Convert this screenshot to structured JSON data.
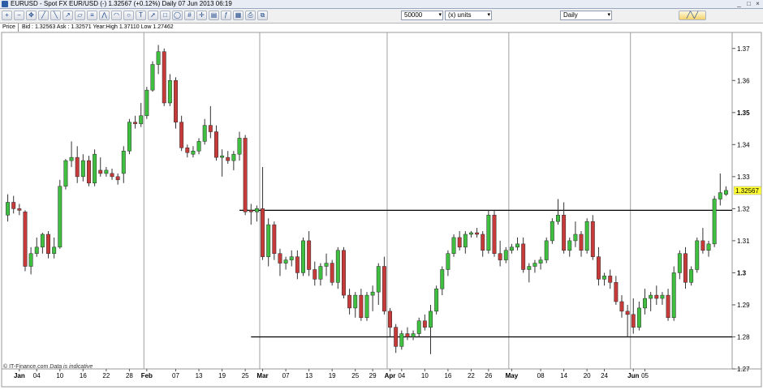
{
  "window": {
    "title": "EURUSD - Spot FX EUR/USD (-)   1.32567 (+0.12%)   Daily  07 Jun 2013 06:19",
    "icon": "chart-window-icon"
  },
  "toolbar": {
    "quantity_value": "50000",
    "units_value": "(x) units",
    "interval_value": "Daily",
    "tool_icons": [
      "zoom-in-icon",
      "zoom-out-icon",
      "pan-icon",
      "trendline-icon",
      "trendline-icon",
      "ray-icon",
      "channel-icon",
      "fib-icon",
      "fan-icon",
      "arc-icon",
      "cycle-icon",
      "text-icon",
      "arrow-icon",
      "rectangle-icon",
      "ellipse-icon",
      "grid-icon",
      "crosshair-icon",
      "layers-icon",
      "indicator-icon",
      "template-icon",
      "print-icon",
      "copy-icon"
    ]
  },
  "info": {
    "price_label": "Price",
    "quote_text": "Bid : 1.32563 Ask : 1.32571  Year:High 1.37110 Low 1.27462"
  },
  "footer": {
    "source": "© IT-Finance.com",
    "note": "Data is indicative"
  },
  "colors": {
    "bull": "#3fbf3f",
    "bear": "#c73a3a",
    "grid": "#c8c8c8",
    "current_price_bg": "#ffff33"
  },
  "chart_data": {
    "type": "candlestick",
    "y_range": [
      1.27,
      1.375
    ],
    "y_ticks": [
      {
        "v": 1.37,
        "label": "1.37",
        "bold": false
      },
      {
        "v": 1.36,
        "label": "1.36",
        "bold": false
      },
      {
        "v": 1.35,
        "label": "1.35",
        "bold": true
      },
      {
        "v": 1.34,
        "label": "1.34",
        "bold": false
      },
      {
        "v": 1.33,
        "label": "1.33",
        "bold": false
      },
      {
        "v": 1.32,
        "label": "1.32",
        "bold": false
      },
      {
        "v": 1.31,
        "label": "1.31",
        "bold": false
      },
      {
        "v": 1.3,
        "label": "1.3",
        "bold": true
      },
      {
        "v": 1.29,
        "label": "1.29",
        "bold": false
      },
      {
        "v": 1.28,
        "label": "1.28",
        "bold": false
      },
      {
        "v": 1.27,
        "label": "1.27",
        "bold": false
      }
    ],
    "x_labels": [
      {
        "label": "Jan",
        "bold": true,
        "i": 2
      },
      {
        "label": "04",
        "bold": false,
        "i": 5
      },
      {
        "label": "10",
        "bold": false,
        "i": 9
      },
      {
        "label": "16",
        "bold": false,
        "i": 13
      },
      {
        "label": "22",
        "bold": false,
        "i": 17
      },
      {
        "label": "28",
        "bold": false,
        "i": 21
      },
      {
        "label": "Feb",
        "bold": true,
        "i": 24
      },
      {
        "label": "07",
        "bold": false,
        "i": 29
      },
      {
        "label": "13",
        "bold": false,
        "i": 33
      },
      {
        "label": "19",
        "bold": false,
        "i": 37
      },
      {
        "label": "25",
        "bold": false,
        "i": 41
      },
      {
        "label": "Mar",
        "bold": true,
        "i": 44
      },
      {
        "label": "07",
        "bold": false,
        "i": 48
      },
      {
        "label": "13",
        "bold": false,
        "i": 52
      },
      {
        "label": "19",
        "bold": false,
        "i": 56
      },
      {
        "label": "25",
        "bold": false,
        "i": 60
      },
      {
        "label": "29",
        "bold": false,
        "i": 63
      },
      {
        "label": "Apr",
        "bold": true,
        "i": 66
      },
      {
        "label": "04",
        "bold": false,
        "i": 68
      },
      {
        "label": "10",
        "bold": false,
        "i": 72
      },
      {
        "label": "16",
        "bold": false,
        "i": 76
      },
      {
        "label": "22",
        "bold": false,
        "i": 80
      },
      {
        "label": "26",
        "bold": false,
        "i": 83
      },
      {
        "label": "May",
        "bold": true,
        "i": 87
      },
      {
        "label": "08",
        "bold": false,
        "i": 92
      },
      {
        "label": "14",
        "bold": false,
        "i": 96
      },
      {
        "label": "20",
        "bold": false,
        "i": 100
      },
      {
        "label": "24",
        "bold": false,
        "i": 103
      },
      {
        "label": "Jun",
        "bold": true,
        "i": 108
      },
      {
        "label": "05",
        "bold": false,
        "i": 110
      }
    ],
    "month_separators": [
      24,
      44,
      66,
      87,
      108
    ],
    "horizontal_lines": [
      {
        "value": 1.3195,
        "from_i": 40,
        "to_i": 116
      },
      {
        "value": 1.28,
        "from_i": 42,
        "to_i": 116
      }
    ],
    "current_price_label": "1.32567",
    "current_price": 1.32567,
    "candles": [
      [
        1.318,
        1.3245,
        1.316,
        1.322
      ],
      [
        1.322,
        1.324,
        1.3185,
        1.32
      ],
      [
        1.32,
        1.3215,
        1.318,
        1.3195
      ],
      [
        1.319,
        1.3195,
        1.3005,
        1.302
      ],
      [
        1.302,
        1.308,
        1.2995,
        1.306
      ],
      [
        1.306,
        1.311,
        1.305,
        1.308
      ],
      [
        1.308,
        1.3125,
        1.306,
        1.312
      ],
      [
        1.312,
        1.313,
        1.3045,
        1.306
      ],
      [
        1.306,
        1.311,
        1.3045,
        1.308
      ],
      [
        1.308,
        1.329,
        1.3075,
        1.327
      ],
      [
        1.327,
        1.3355,
        1.326,
        1.335
      ],
      [
        1.335,
        1.341,
        1.333,
        1.336
      ],
      [
        1.336,
        1.3395,
        1.328,
        1.33
      ],
      [
        1.33,
        1.337,
        1.3285,
        1.335
      ],
      [
        1.335,
        1.3365,
        1.327,
        1.328
      ],
      [
        1.328,
        1.3385,
        1.327,
        1.337
      ],
      [
        1.332,
        1.336,
        1.33,
        1.331
      ],
      [
        1.331,
        1.333,
        1.33,
        1.332
      ],
      [
        1.331,
        1.3325,
        1.329,
        1.33
      ],
      [
        1.33,
        1.331,
        1.3275,
        1.329
      ],
      [
        1.331,
        1.3395,
        1.328,
        1.338
      ],
      [
        1.338,
        1.348,
        1.337,
        1.347
      ],
      [
        1.347,
        1.349,
        1.345,
        1.3465
      ],
      [
        1.3465,
        1.353,
        1.3455,
        1.349
      ],
      [
        1.349,
        1.358,
        1.348,
        1.357
      ],
      [
        1.357,
        1.366,
        1.3565,
        1.365
      ],
      [
        1.365,
        1.3711,
        1.362,
        1.369
      ],
      [
        1.369,
        1.37,
        1.352,
        1.353
      ],
      [
        1.353,
        1.362,
        1.352,
        1.36
      ],
      [
        1.36,
        1.361,
        1.345,
        1.347
      ],
      [
        1.347,
        1.349,
        1.338,
        1.339
      ],
      [
        1.339,
        1.34,
        1.336,
        1.3375
      ],
      [
        1.337,
        1.3395,
        1.336,
        1.338
      ],
      [
        1.338,
        1.342,
        1.337,
        1.341
      ],
      [
        1.341,
        1.348,
        1.34,
        1.346
      ],
      [
        1.346,
        1.352,
        1.342,
        1.344
      ],
      [
        1.344,
        1.346,
        1.335,
        1.336
      ],
      [
        1.336,
        1.3385,
        1.33,
        1.3365
      ],
      [
        1.336,
        1.338,
        1.334,
        1.335
      ],
      [
        1.335,
        1.338,
        1.332,
        1.337
      ],
      [
        1.337,
        1.344,
        1.335,
        1.342
      ],
      [
        1.342,
        1.343,
        1.318,
        1.319
      ],
      [
        1.3195,
        1.3215,
        1.315,
        1.319
      ],
      [
        1.319,
        1.321,
        1.316,
        1.32
      ],
      [
        1.32,
        1.333,
        1.304,
        1.305
      ],
      [
        1.305,
        1.317,
        1.302,
        1.315
      ],
      [
        1.315,
        1.316,
        1.304,
        1.306
      ],
      [
        1.306,
        1.3075,
        1.299,
        1.303
      ],
      [
        1.303,
        1.305,
        1.301,
        1.304
      ],
      [
        1.304,
        1.307,
        1.302,
        1.305
      ],
      [
        1.305,
        1.307,
        1.298,
        1.3
      ],
      [
        1.3,
        1.311,
        1.299,
        1.31
      ],
      [
        1.31,
        1.313,
        1.299,
        1.301
      ],
      [
        1.301,
        1.3035,
        1.296,
        1.298
      ],
      [
        1.298,
        1.303,
        1.296,
        1.302
      ],
      [
        1.302,
        1.306,
        1.299,
        1.303
      ],
      [
        1.303,
        1.304,
        1.296,
        1.297
      ],
      [
        1.297,
        1.308,
        1.295,
        1.307
      ],
      [
        1.307,
        1.308,
        1.292,
        1.293
      ],
      [
        1.293,
        1.295,
        1.287,
        1.289
      ],
      [
        1.289,
        1.294,
        1.286,
        1.293
      ],
      [
        1.293,
        1.295,
        1.285,
        1.286
      ],
      [
        1.286,
        1.294,
        1.285,
        1.293
      ],
      [
        1.293,
        1.296,
        1.288,
        1.294
      ],
      [
        1.294,
        1.303,
        1.29,
        1.302
      ],
      [
        1.302,
        1.305,
        1.287,
        1.288
      ],
      [
        1.288,
        1.289,
        1.28,
        1.283
      ],
      [
        1.283,
        1.284,
        1.275,
        1.277
      ],
      [
        1.277,
        1.282,
        1.276,
        1.281
      ],
      [
        1.281,
        1.283,
        1.279,
        1.28
      ],
      [
        1.28,
        1.282,
        1.279,
        1.281
      ],
      [
        1.281,
        1.286,
        1.28,
        1.285
      ],
      [
        1.285,
        1.287,
        1.282,
        1.283
      ],
      [
        1.283,
        1.29,
        1.2746,
        1.288
      ],
      [
        1.288,
        1.296,
        1.287,
        1.295
      ],
      [
        1.295,
        1.302,
        1.293,
        1.301
      ],
      [
        1.301,
        1.307,
        1.299,
        1.306
      ],
      [
        1.306,
        1.312,
        1.305,
        1.311
      ],
      [
        1.311,
        1.313,
        1.307,
        1.308
      ],
      [
        1.308,
        1.313,
        1.306,
        1.312
      ],
      [
        1.312,
        1.313,
        1.311,
        1.3125
      ],
      [
        1.3125,
        1.314,
        1.311,
        1.312
      ],
      [
        1.312,
        1.313,
        1.305,
        1.307
      ],
      [
        1.307,
        1.3195,
        1.306,
        1.318
      ],
      [
        1.318,
        1.3195,
        1.305,
        1.306
      ],
      [
        1.306,
        1.31,
        1.302,
        1.304
      ],
      [
        1.304,
        1.308,
        1.303,
        1.307
      ],
      [
        1.307,
        1.309,
        1.306,
        1.308
      ],
      [
        1.308,
        1.311,
        1.307,
        1.309
      ],
      [
        1.309,
        1.311,
        1.3,
        1.301
      ],
      [
        1.301,
        1.303,
        1.297,
        1.302
      ],
      [
        1.302,
        1.304,
        1.3,
        1.303
      ],
      [
        1.303,
        1.305,
        1.301,
        1.304
      ],
      [
        1.304,
        1.311,
        1.303,
        1.31
      ],
      [
        1.31,
        1.317,
        1.309,
        1.316
      ],
      [
        1.316,
        1.323,
        1.315,
        1.318
      ],
      [
        1.318,
        1.322,
        1.306,
        1.307
      ],
      [
        1.307,
        1.311,
        1.305,
        1.31
      ],
      [
        1.31,
        1.316,
        1.308,
        1.312
      ],
      [
        1.312,
        1.313,
        1.305,
        1.307
      ],
      [
        1.307,
        1.317,
        1.306,
        1.316
      ],
      [
        1.316,
        1.318,
        1.304,
        1.305
      ],
      [
        1.305,
        1.308,
        1.296,
        1.298
      ],
      [
        1.298,
        1.3,
        1.296,
        1.299
      ],
      [
        1.299,
        1.301,
        1.295,
        1.297
      ],
      [
        1.297,
        1.299,
        1.29,
        1.291
      ],
      [
        1.291,
        1.293,
        1.286,
        1.288
      ],
      [
        1.288,
        1.29,
        1.28,
        1.287
      ],
      [
        1.287,
        1.292,
        1.281,
        1.283
      ],
      [
        1.283,
        1.291,
        1.282,
        1.289
      ],
      [
        1.289,
        1.295,
        1.287,
        1.292
      ],
      [
        1.292,
        1.294,
        1.288,
        1.293
      ],
      [
        1.293,
        1.296,
        1.29,
        1.292
      ],
      [
        1.292,
        1.294,
        1.29,
        1.293
      ],
      [
        1.293,
        1.295,
        1.285,
        1.286
      ],
      [
        1.286,
        1.302,
        1.285,
        1.3
      ],
      [
        1.3,
        1.307,
        1.298,
        1.306
      ],
      [
        1.306,
        1.308,
        1.295,
        1.297
      ],
      [
        1.297,
        1.302,
        1.296,
        1.301
      ],
      [
        1.301,
        1.311,
        1.3,
        1.31
      ],
      [
        1.31,
        1.314,
        1.306,
        1.307
      ],
      [
        1.307,
        1.31,
        1.305,
        1.309
      ],
      [
        1.309,
        1.324,
        1.308,
        1.323
      ],
      [
        1.323,
        1.331,
        1.321,
        1.325
      ],
      [
        1.3245,
        1.327,
        1.324,
        1.3257
      ]
    ]
  }
}
